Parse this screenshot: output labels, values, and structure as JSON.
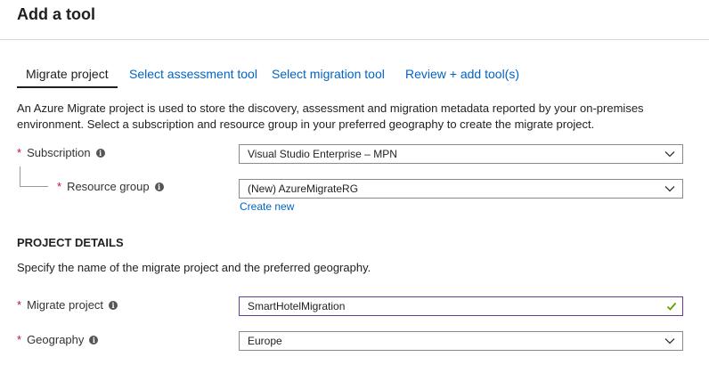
{
  "header": {
    "title": "Add a tool"
  },
  "tabs": [
    {
      "label": "Migrate project",
      "active": true
    },
    {
      "label": "Select assessment tool",
      "active": false
    },
    {
      "label": "Select migration tool",
      "active": false
    },
    {
      "label": "Review + add tool(s)",
      "active": false
    }
  ],
  "description": "An Azure Migrate project is used to store the discovery, assessment and migration metadata reported by your on-premises environment. Select a subscription and resource group in your preferred geography to create the migrate project.",
  "form": {
    "required_marker": "*",
    "subscription": {
      "label": "Subscription",
      "value": "Visual Studio Enterprise – MPN"
    },
    "resource_group": {
      "label": "Resource group",
      "value": "(New) AzureMigrateRG",
      "create_new": "Create new"
    }
  },
  "project_details": {
    "title": "PROJECT DETAILS",
    "description": "Specify the name of the migrate project and the preferred geography.",
    "migrate_project": {
      "label": "Migrate project",
      "value": "SmartHotelMigration"
    },
    "geography": {
      "label": "Geography",
      "value": "Europe"
    }
  },
  "colors": {
    "link": "#0065c2",
    "required": "#c8102e",
    "valid_check": "#5ea500",
    "focus_border": "#6c3a97"
  },
  "icons": [
    "info-icon",
    "chevron-down-icon",
    "checkmark-icon"
  ]
}
